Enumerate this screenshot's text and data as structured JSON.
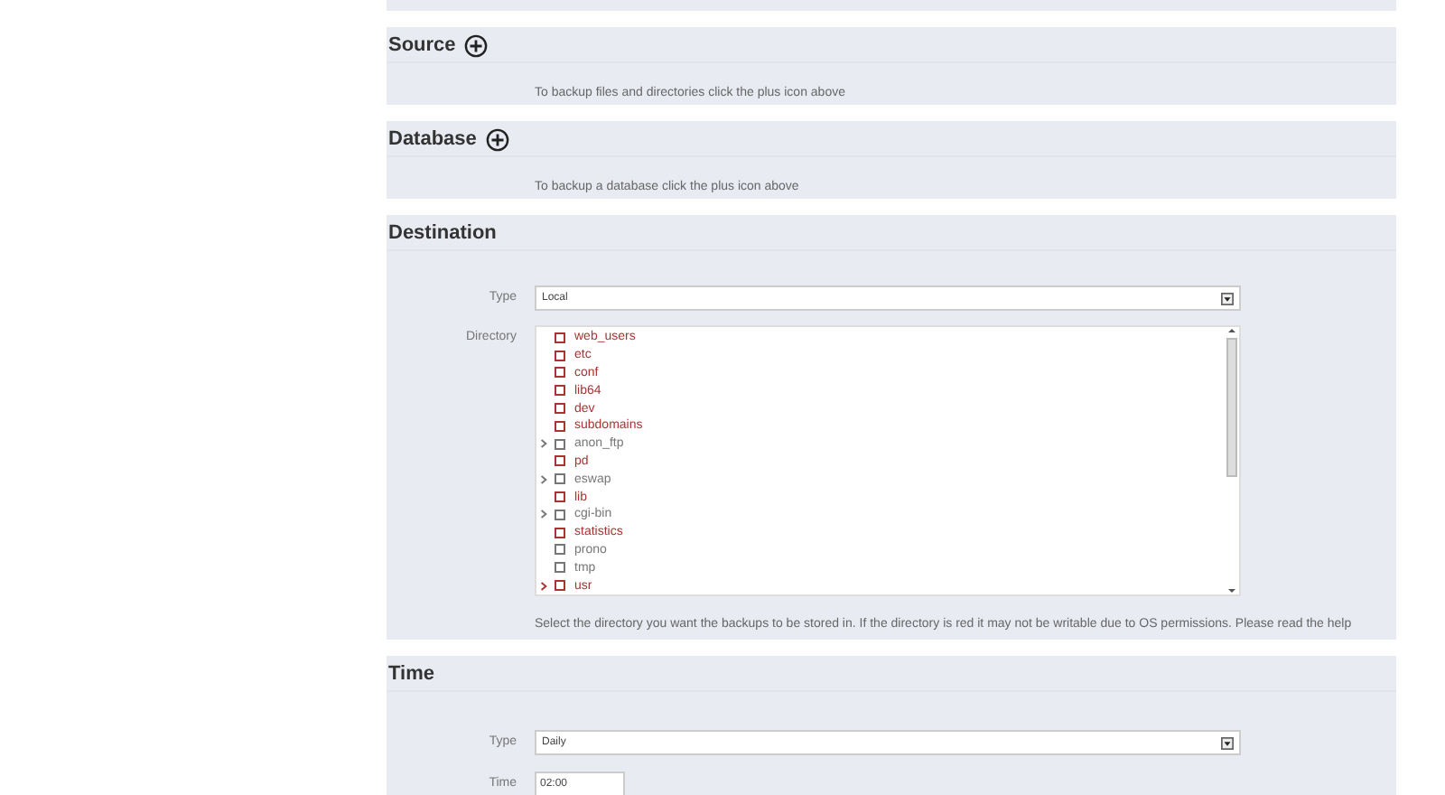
{
  "sections": [
    {
      "title": "Source",
      "add_button": true,
      "hint": "To backup files and directories click the plus icon above"
    },
    {
      "title": "Database",
      "add_button": true,
      "hint": "To backup a database click the plus icon above"
    }
  ],
  "destination": {
    "title": "Destination",
    "type_label": "Type",
    "type_value": "Local",
    "directory_label": "Directory",
    "directories": [
      {
        "name": "web_users",
        "writable": false,
        "expandable": false,
        "checked": false
      },
      {
        "name": "etc",
        "writable": false,
        "expandable": false,
        "checked": false
      },
      {
        "name": "conf",
        "writable": false,
        "expandable": false,
        "checked": false
      },
      {
        "name": "lib64",
        "writable": false,
        "expandable": false,
        "checked": false
      },
      {
        "name": "dev",
        "writable": false,
        "expandable": false,
        "checked": false
      },
      {
        "name": "subdomains",
        "writable": false,
        "expandable": false,
        "checked": false
      },
      {
        "name": "anon_ftp",
        "writable": true,
        "expandable": true,
        "checked": false
      },
      {
        "name": "pd",
        "writable": false,
        "expandable": false,
        "checked": false
      },
      {
        "name": "eswap",
        "writable": true,
        "expandable": true,
        "checked": false
      },
      {
        "name": "lib",
        "writable": false,
        "expandable": false,
        "checked": false
      },
      {
        "name": "cgi-bin",
        "writable": true,
        "expandable": true,
        "checked": false
      },
      {
        "name": "statistics",
        "writable": false,
        "expandable": false,
        "checked": false
      },
      {
        "name": "prono",
        "writable": true,
        "expandable": false,
        "checked": false
      },
      {
        "name": "tmp",
        "writable": true,
        "expandable": false,
        "checked": false
      },
      {
        "name": "usr",
        "writable": false,
        "expandable": true,
        "checked": false
      }
    ],
    "help": "Select the directory you want the backups to be stored in. If the directory is red it may not be writable due to OS permissions. Please read the help"
  },
  "time": {
    "title": "Time",
    "type_label": "Type",
    "type_value": "Daily",
    "time_label": "Time",
    "time_value": "02:00"
  }
}
